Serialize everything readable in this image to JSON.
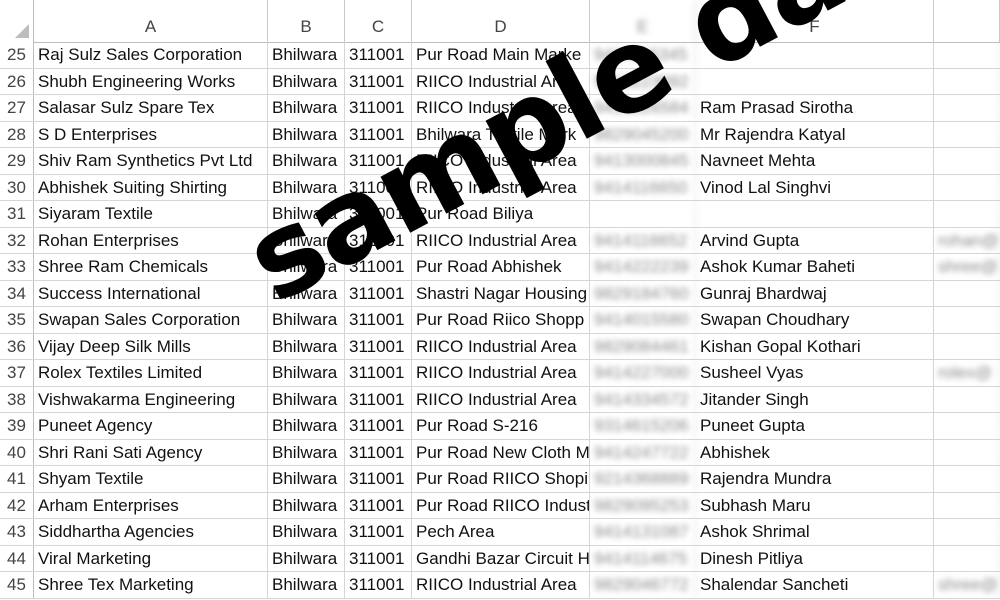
{
  "columns": [
    "A",
    "B",
    "C",
    "D",
    "E",
    "F",
    ""
  ],
  "rows": [
    {
      "n": "25",
      "a": "Raj Sulz Sales Corporation",
      "b": "Bhilwara",
      "c": "311001",
      "d": "Pur Road Main Marke",
      "e": "9414115345",
      "f": "",
      "g": ""
    },
    {
      "n": "26",
      "a": "Shubh Engineering Works",
      "b": "Bhilwara",
      "c": "311001",
      "d": "RIICO Industrial Area",
      "e": "9413223092",
      "f": "",
      "g": ""
    },
    {
      "n": "27",
      "a": "Salasar Sulz Spare Tex",
      "b": "Bhilwara",
      "c": "311001",
      "d": "RIICO Industrial Area",
      "e": "9413226584",
      "f": "Ram Prasad Sirotha",
      "g": ""
    },
    {
      "n": "28",
      "a": "S D Enterprises",
      "b": "Bhilwara",
      "c": "311001",
      "d": "Bhilwara Textile Mark",
      "e": "9829045200",
      "f": "Mr Rajendra Katyal",
      "g": ""
    },
    {
      "n": "29",
      "a": "Shiv Ram Synthetics Pvt Ltd",
      "b": "Bhilwara",
      "c": "311001",
      "d": "RIICO Industrial Area",
      "e": "9413000845",
      "f": "Navneet Mehta",
      "g": ""
    },
    {
      "n": "30",
      "a": "Abhishek Suiting Shirting",
      "b": "Bhilwara",
      "c": "311001",
      "d": "RIICO Industrial Area",
      "e": "9414116650",
      "f": "Vinod Lal Singhvi",
      "g": ""
    },
    {
      "n": "31",
      "a": "Siyaram Textile",
      "b": "Bhilwara",
      "c": "311001",
      "d": "Pur Road Biliya",
      "e": "",
      "f": "",
      "g": ""
    },
    {
      "n": "32",
      "a": "Rohan Enterprises",
      "b": "Bhilwara",
      "c": "311001",
      "d": "RIICO Industrial Area",
      "e": "9414116652",
      "f": "Arvind Gupta",
      "g": "rohan@"
    },
    {
      "n": "33",
      "a": "Shree Ram Chemicals",
      "b": "Bhilwara",
      "c": "311001",
      "d": "Pur Road Abhishek",
      "e": "9414222239",
      "f": "Ashok Kumar Baheti",
      "g": "shree@"
    },
    {
      "n": "34",
      "a": "Success International",
      "b": "Bhilwara",
      "c": "311001",
      "d": "Shastri Nagar Housing",
      "e": "9829184760",
      "f": "Gunraj Bhardwaj",
      "g": ""
    },
    {
      "n": "35",
      "a": "Swapan Sales Corporation",
      "b": "Bhilwara",
      "c": "311001",
      "d": "Pur Road Riico Shopp",
      "e": "9414015580",
      "f": "Swapan Choudhary",
      "g": ""
    },
    {
      "n": "36",
      "a": "Vijay Deep Silk Mills",
      "b": "Bhilwara",
      "c": "311001",
      "d": "RIICO Industrial Area",
      "e": "9829084461",
      "f": "Kishan Gopal Kothari",
      "g": ""
    },
    {
      "n": "37",
      "a": "Rolex Textiles Limited",
      "b": "Bhilwara",
      "c": "311001",
      "d": "RIICO Industrial Area",
      "e": "9414227000",
      "f": "Susheel Vyas",
      "g": "rolex@"
    },
    {
      "n": "38",
      "a": "Vishwakarma Engineering",
      "b": "Bhilwara",
      "c": "311001",
      "d": "RIICO Industrial Area",
      "e": "9414334572",
      "f": "Jitander Singh",
      "g": ""
    },
    {
      "n": "39",
      "a": "Puneet Agency",
      "b": "Bhilwara",
      "c": "311001",
      "d": "Pur Road  S-216",
      "e": "9314615206",
      "f": "Puneet Gupta",
      "g": ""
    },
    {
      "n": "40",
      "a": "Shri Rani Sati Agency",
      "b": "Bhilwara",
      "c": "311001",
      "d": "Pur Road New Cloth M",
      "e": "9414247722",
      "f": "Abhishek",
      "g": ""
    },
    {
      "n": "41",
      "a": "Shyam Textile",
      "b": "Bhilwara",
      "c": "311001",
      "d": "Pur Road RIICO Shopi",
      "e": "9214368889",
      "f": "Rajendra Mundra",
      "g": ""
    },
    {
      "n": "42",
      "a": "Arham Enterprises",
      "b": "Bhilwara",
      "c": "311001",
      "d": "Pur Road RIICO Indust",
      "e": "9829095253",
      "f": "Subhash Maru",
      "g": ""
    },
    {
      "n": "43",
      "a": "Siddhartha Agencies",
      "b": "Bhilwara",
      "c": "311001",
      "d": "Pech Area",
      "e": "9414131087",
      "f": "Ashok Shrimal",
      "g": ""
    },
    {
      "n": "44",
      "a": "Viral Marketing",
      "b": "Bhilwara",
      "c": "311001",
      "d": "Gandhi Bazar Circuit H",
      "e": "9414114675",
      "f": "Dinesh Pitliya",
      "g": ""
    },
    {
      "n": "45",
      "a": "Shree Tex Marketing",
      "b": "Bhilwara",
      "c": "311001",
      "d": "RIICO Industrial Area",
      "e": "9829046772",
      "f": "Shalendar Sancheti",
      "g": "shree@"
    }
  ],
  "watermark": "sample data"
}
